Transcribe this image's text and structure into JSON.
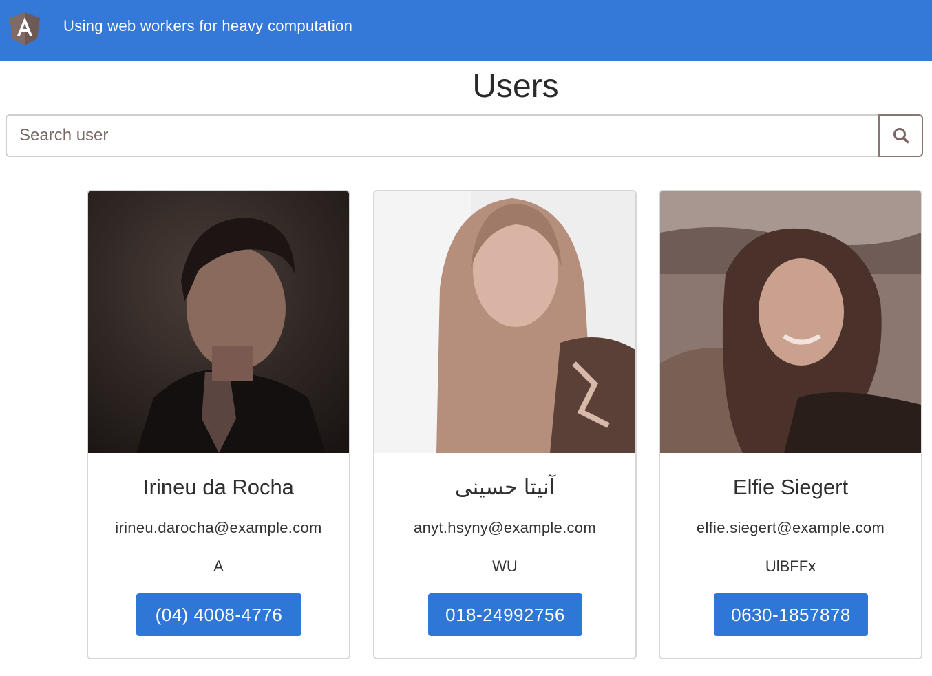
{
  "navbar": {
    "logo_icon": "angular-logo-icon",
    "title": "Using web workers for heavy computation",
    "color": "#3479d8"
  },
  "page": {
    "title": "Users"
  },
  "search": {
    "placeholder": "Search user",
    "value": "",
    "button_icon": "search-icon"
  },
  "users": [
    {
      "name": "Irineu da Rocha",
      "email": "irineu.darocha@example.com",
      "code": "A",
      "phone": "(04) 4008-4776"
    },
    {
      "name": "آنیتا حسینی",
      "email": "anyt.hsyny@example.com",
      "code": "WU",
      "phone": "018-24992756"
    },
    {
      "name": "Elfie Siegert",
      "email": "elfie.siegert@example.com",
      "code": "UlBFFx",
      "phone": "0630-1857878"
    }
  ],
  "colors": {
    "accent": "#2f77d6",
    "card_border": "#d6d6d6"
  }
}
